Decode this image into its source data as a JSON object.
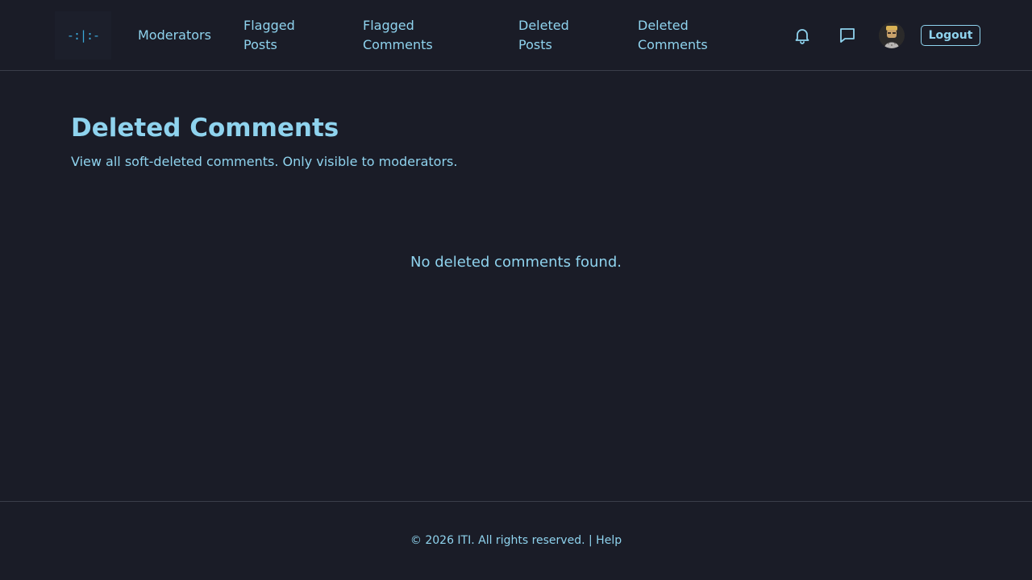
{
  "header": {
    "logo_text": "-:|:-",
    "nav": {
      "moderators": "Moderators",
      "flagged_posts": "Flagged Posts",
      "flagged_comments": "Flagged Comments",
      "deleted_posts": "Deleted Posts",
      "deleted_comments": "Deleted Comments"
    },
    "icons": {
      "notifications": "bell-icon",
      "messages": "chat-bubble-icon"
    },
    "logout_label": "Logout"
  },
  "main": {
    "title": "Deleted Comments",
    "subtitle": "View all soft-deleted comments. Only visible to moderators.",
    "empty_message": "No deleted comments found."
  },
  "footer": {
    "copyright": "© 2026 ITI. All rights reserved.",
    "separator": "|",
    "help_label": "Help"
  },
  "colors": {
    "background": "#1a1c27",
    "accent": "#8fd3ee",
    "border": "#3a3d4a"
  }
}
